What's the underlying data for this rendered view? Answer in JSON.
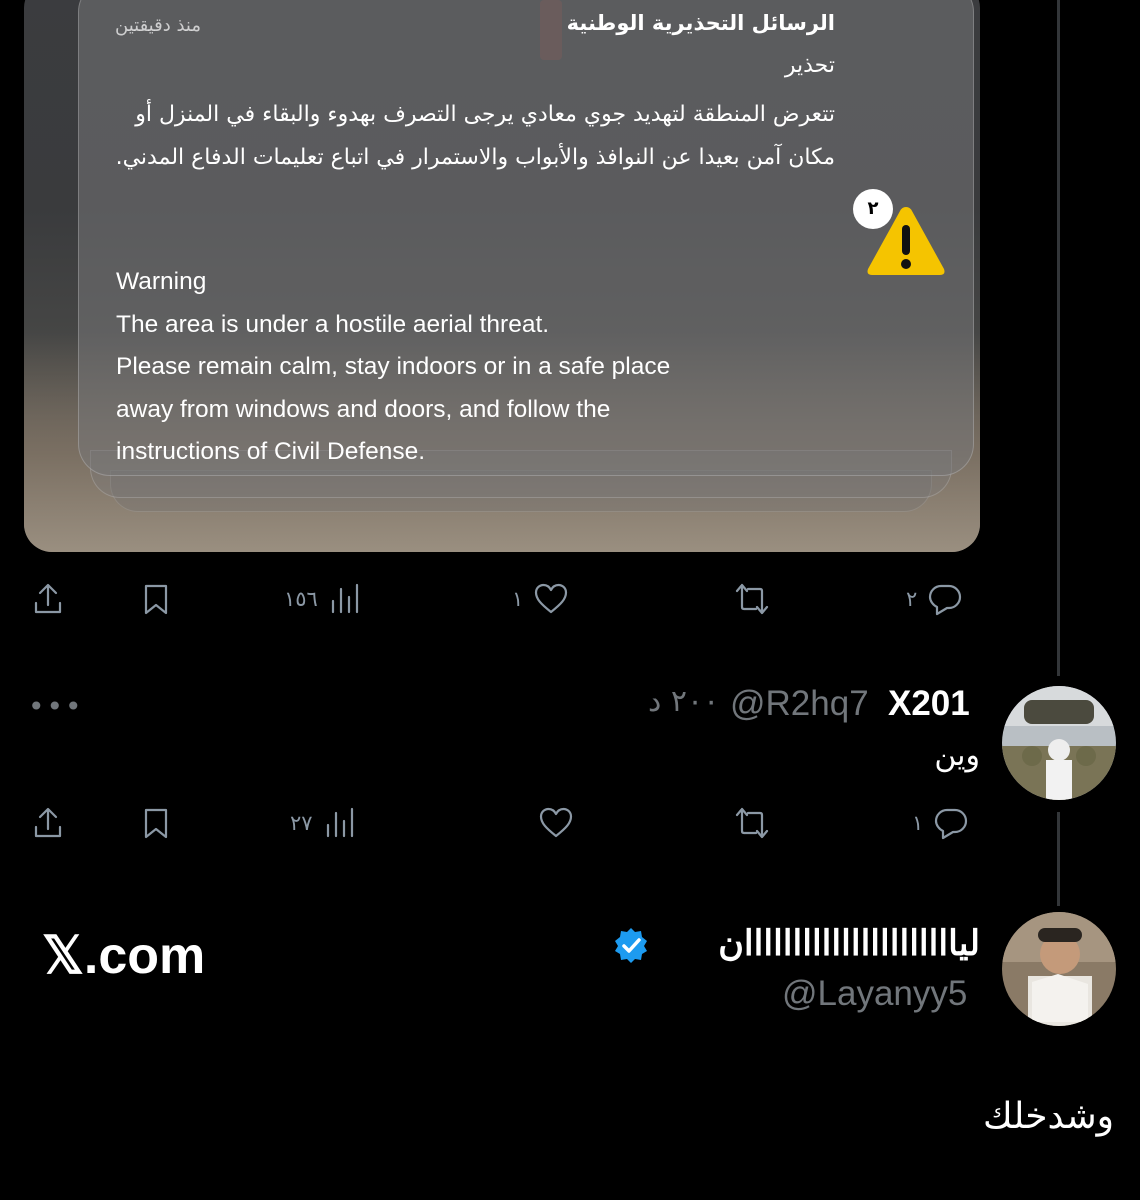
{
  "notification": {
    "app_title": "الرسائل التحذيرية الوطنية",
    "time": "منذ دقيقتين",
    "subtitle": "تحذير",
    "body_ar": "تتعرض المنطقة لتهديد جوي معادي يرجى التصرف بهدوء والبقاء في المنزل أو مكان آمن بعيدا عن النوافذ والأبواب والاستمرار في اتباع تعليمات الدفاع المدني.",
    "body_en": "Warning\nThe area is under a hostile aerial threat.\nPlease remain calm, stay indoors or in a safe place\naway from windows and doors, and follow the\ninstructions of Civil Defense.",
    "badge_count": "٢",
    "icon": "warning-triangle-icon",
    "icon_color": "#f5c400"
  },
  "tweet1_actions": {
    "replies": "٢",
    "retweets": "",
    "likes": "١",
    "views": "١٥٦"
  },
  "reply1": {
    "name": "X201",
    "handle": "@R2hq7",
    "time": "٢٠٠ د",
    "text": "وين",
    "more": "•••"
  },
  "reply1_actions": {
    "replies": "١",
    "retweets": "",
    "likes": "",
    "views": "٢٧"
  },
  "reply2": {
    "name": "لياااااااااااااااااااااان",
    "handle": "@Layanyy5",
    "text": "وشدخلك",
    "verified_color": "#1d9bf0"
  },
  "watermark": "𝕏.com",
  "colors": {
    "background": "#000000",
    "icon_gray": "#8b98a5",
    "handle_gray": "#71767b"
  }
}
